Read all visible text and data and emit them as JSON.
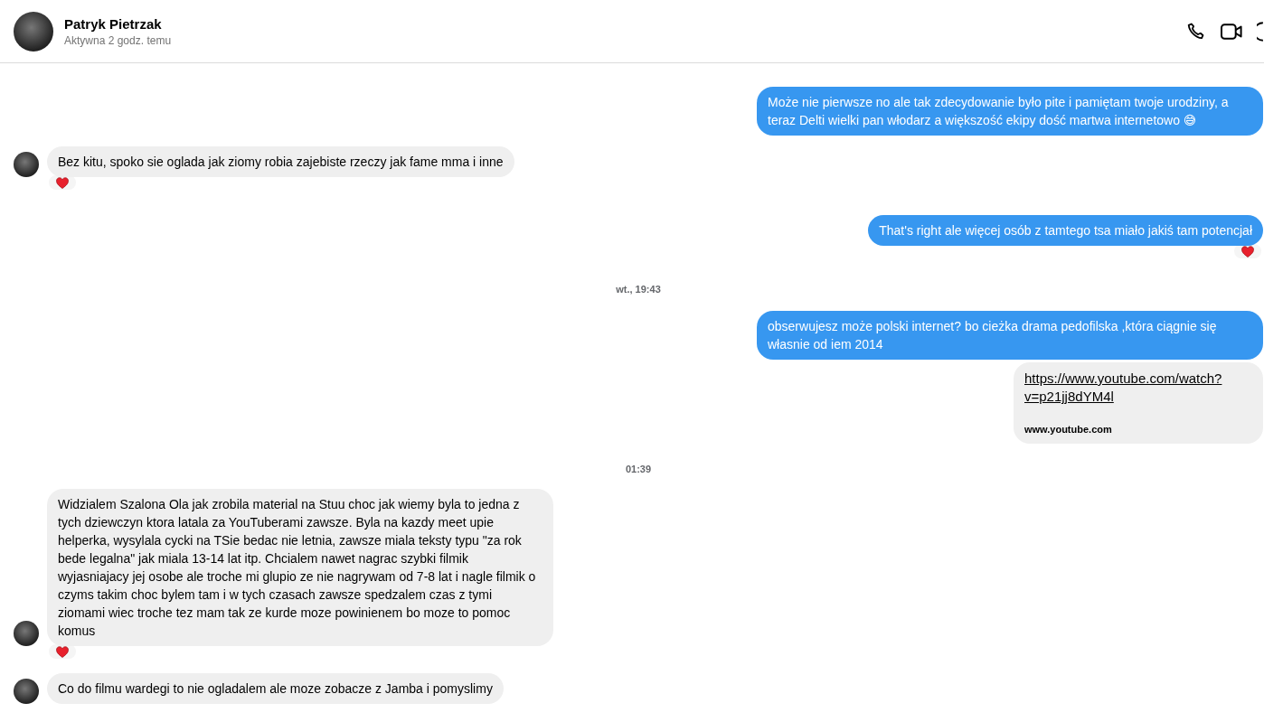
{
  "header": {
    "name": "Patryk Pietrzak",
    "status": "Aktywna 2 godz. temu"
  },
  "messages": [
    {
      "kind": "outgoing",
      "text": "Może nie pierwsze no ale tak zdecydowanie było pite i pamiętam twoje urodziny, a teraz Delti wielki pan włodarz a większość ekipy dość martwa internetowo 😅",
      "reacted": false
    },
    {
      "kind": "incoming",
      "text": "Bez kitu, spoko sie oglada jak ziomy robia zajebiste rzeczy jak fame mma i inne",
      "reacted": true
    },
    {
      "kind": "outgoing",
      "text": "That's right ale więcej osób z tamtego tsa miało jakiś tam potencjał",
      "reacted": true
    },
    {
      "kind": "timestamp",
      "text": "wt., 19:43"
    },
    {
      "kind": "outgoing",
      "text": "obserwujesz może polski internet? bo cieżka drama pedofilska ,która ciągnie się własnie od iem 2014",
      "reacted": false
    },
    {
      "kind": "link",
      "url": "https://www.youtube.com/watch?v=p21jj8dYM4l",
      "domain": "www.youtube.com"
    },
    {
      "kind": "timestamp",
      "text": "01:39"
    },
    {
      "kind": "incoming",
      "text": "Widzialem Szalona Ola jak zrobila material na Stuu choc jak wiemy byla to jedna z tych dziewczyn ktora latala za YouTuberami zawsze. Byla na kazdy meet upie helperka, wysylala cycki na TSie bedac nie letnia, zawsze miala teksty typu \"za rok bede legalna\" jak miala 13-14 lat itp. Chcialem nawet nagrac szybki filmik wyjasniajacy jej osobe ale troche mi glupio ze nie nagrywam od 7-8 lat i nagle filmik o czyms takim choc bylem tam i w tych czasach zawsze spedzalem czas z tymi ziomami wiec troche tez mam tak ze kurde moze powinienem bo moze to pomoc komus",
      "reacted": true
    },
    {
      "kind": "incoming",
      "text": "Co do filmu wardegi to nie ogladalem ale moze zobacze z Jamba i pomyslimy",
      "reacted": false
    }
  ]
}
